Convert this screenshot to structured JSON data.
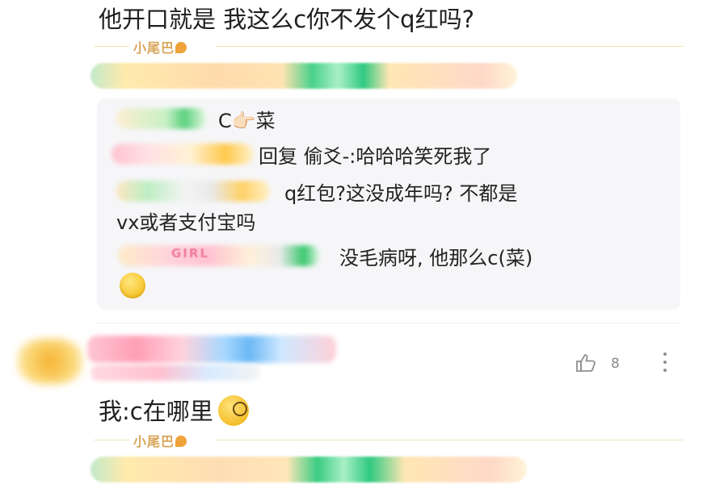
{
  "post": {
    "text": "他开口就是 我这么c你不发个q红吗?"
  },
  "tail": {
    "label": "小尾巴"
  },
  "reply_box": {
    "replies": [
      {
        "text": "C👉🏻菜"
      },
      {
        "text": "回复 偷爻-:哈哈哈笑死我了"
      },
      {
        "text_line1": "q红包?这没成年吗? 不都是",
        "text_line2": "vx或者支付宝吗"
      },
      {
        "text": "没毛病呀, 他那么c(菜)"
      }
    ],
    "girl_badge": "GIRL"
  },
  "comment": {
    "likes": "8",
    "text": "我:c在哪里"
  },
  "tail2": {
    "label": "小尾巴"
  },
  "colors": {
    "tail_label": "#d8a55a",
    "reply_bg": "#f6f6f8",
    "divider": "#efefef"
  }
}
